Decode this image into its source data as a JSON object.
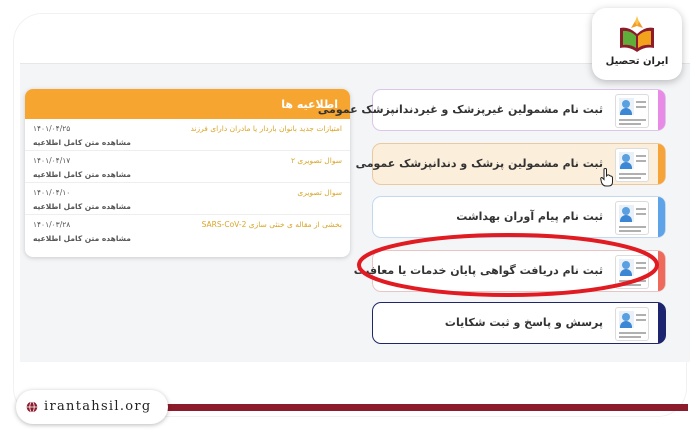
{
  "logo": {
    "text": "ایران تحصیل"
  },
  "notices": {
    "title": "اطلاعیه ها",
    "items": [
      {
        "title": "امتیازات جدید بانوان باردار یا مادران دارای فرزند",
        "date": "۱۴۰۱/۰۴/۲۵",
        "link": "مشاهده متن کامل اطلاعیه"
      },
      {
        "title": "سوال تصویری ۲",
        "date": "۱۴۰۱/۰۴/۱۷",
        "link": "مشاهده متن کامل اطلاعیه"
      },
      {
        "title": "سوال تصویری",
        "date": "۱۴۰۱/۰۴/۱۰",
        "link": "مشاهده متن کامل اطلاعیه"
      },
      {
        "title": "بخشی از مقاله ی خنثی سازی SARS-CoV-2",
        "date": "۱۴۰۱/۰۳/۲۸",
        "link": "مشاهده متن کامل اطلاعیه"
      }
    ]
  },
  "menu": [
    {
      "label": "ثبت نام مشمولین غیرپزشک و غیردندانپزشک عمومی",
      "accent": "#e88be6"
    },
    {
      "label": "ثبت نام مشمولین پزشک و دندانپزشک عمومی",
      "accent": "#f6a43a"
    },
    {
      "label": "ثبت نام پیام آوران بهداشت",
      "accent": "#5ea2e8"
    },
    {
      "label": "ثبت نام دریافت گواهی پایان خدمات یا معافیت",
      "accent": "#ee6a5c"
    },
    {
      "label": "پرسش و پاسخ و ثبت شکایات",
      "accent": "#1d2470"
    }
  ],
  "footer": {
    "website": "irantahsil.org"
  },
  "colors": {
    "highlight_ring": "#e01b22",
    "footer_bar": "#8c1c2c",
    "notice_header": "#f7a531"
  }
}
